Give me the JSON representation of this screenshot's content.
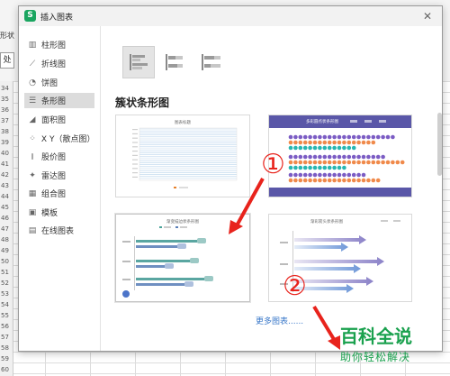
{
  "dialog": {
    "title": "插入图表",
    "close_icon": "close-icon"
  },
  "sidebar": {
    "items": [
      {
        "label": "柱形图",
        "icon": "column-chart-icon"
      },
      {
        "label": "折线图",
        "icon": "line-chart-icon"
      },
      {
        "label": "饼图",
        "icon": "pie-chart-icon"
      },
      {
        "label": "条形图",
        "icon": "bar-chart-icon",
        "active": true
      },
      {
        "label": "面积图",
        "icon": "area-chart-icon"
      },
      {
        "label": "X Y（散点图）",
        "icon": "scatter-chart-icon"
      },
      {
        "label": "股价图",
        "icon": "stock-chart-icon"
      },
      {
        "label": "雷达图",
        "icon": "radar-chart-icon"
      },
      {
        "label": "组合图",
        "icon": "combo-chart-icon"
      },
      {
        "label": "模板",
        "icon": "template-icon"
      },
      {
        "label": "在线图表",
        "icon": "online-chart-icon"
      }
    ]
  },
  "content": {
    "subtypes": [
      "clustered-bar",
      "stacked-bar",
      "percent-stacked-bar"
    ],
    "section_title": "簇状条形图",
    "thumbnails": [
      {
        "title": "图表标题"
      },
      {
        "title": "多彩圆点状条形图"
      },
      {
        "title": "渐变描边状条形图"
      },
      {
        "title": "渐彩箭头状条形图"
      }
    ],
    "more_link": "更多图表......"
  },
  "annotations": {
    "step1": "①",
    "step2": "②",
    "color": "#e8231c"
  },
  "watermark": {
    "main": "百科全说",
    "sub": "助你轻松解决",
    "color": "#1aa14e"
  },
  "background": {
    "fragment1": "形状",
    "button": "处",
    "row_numbers": [
      "34",
      "35",
      "36",
      "37",
      "38",
      "39",
      "40",
      "41",
      "42",
      "43",
      "44",
      "45",
      "46",
      "47",
      "48",
      "49",
      "50",
      "51",
      "52",
      "53",
      "54",
      "55",
      "56",
      "57",
      "58",
      "59",
      "60"
    ]
  }
}
